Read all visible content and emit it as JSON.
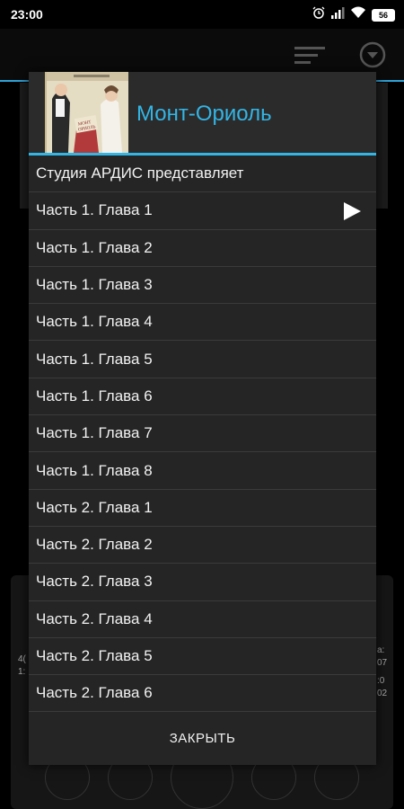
{
  "status_bar": {
    "time": "23:00",
    "battery": "56"
  },
  "icons": {
    "alarm": "alarm-icon",
    "signal": "signal-icon",
    "wifi": "wifi-icon",
    "menu": "menu-icon",
    "dropdown": "chevron-down-circle-icon",
    "play": "play-icon"
  },
  "background": {
    "left_text_1": "4(",
    "left_text_2": "1:",
    "right_text_1": "а:",
    "right_text_2": "07",
    "right_text_3": ":0",
    "right_text_4": "02"
  },
  "dialog": {
    "title": "Монт-Ориоль",
    "accent_color": "#33b5e5",
    "items": [
      {
        "label": "Студия АРДИС представляет"
      },
      {
        "label": "Часть 1. Глава 1",
        "playing": true
      },
      {
        "label": "Часть 1. Глава 2"
      },
      {
        "label": "Часть 1. Глава 3"
      },
      {
        "label": "Часть 1. Глава 4"
      },
      {
        "label": "Часть 1. Глава 5"
      },
      {
        "label": "Часть 1. Глава 6"
      },
      {
        "label": "Часть 1. Глава 7"
      },
      {
        "label": "Часть 1. Глава 8"
      },
      {
        "label": "Часть 2. Глава 1"
      },
      {
        "label": "Часть 2. Глава 2"
      },
      {
        "label": "Часть 2. Глава 3"
      },
      {
        "label": "Часть 2. Глава 4"
      },
      {
        "label": "Часть 2. Глава 5"
      },
      {
        "label": "Часть 2. Глава 6"
      }
    ],
    "close_label": "ЗАКРЫТЬ"
  }
}
